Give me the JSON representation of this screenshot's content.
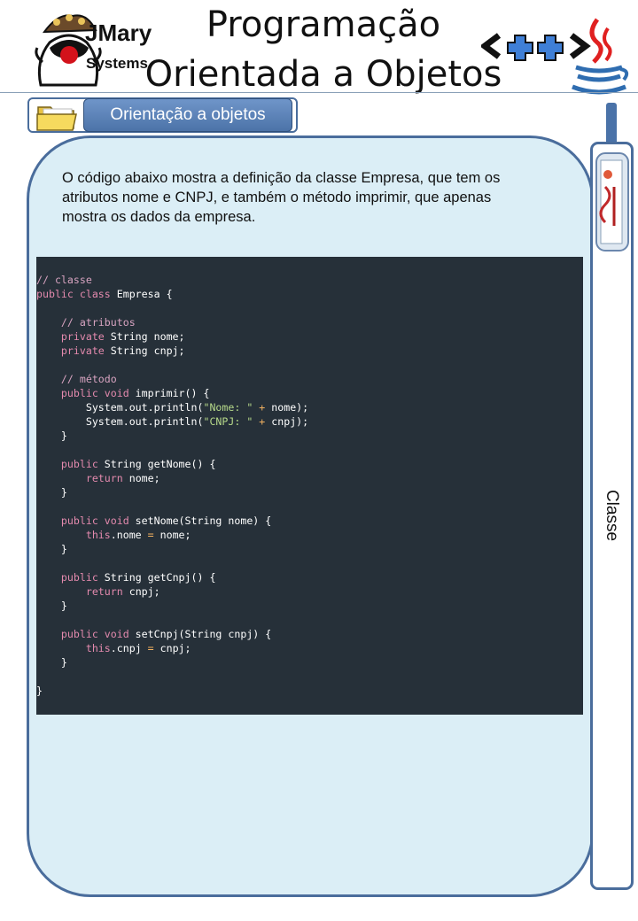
{
  "header": {
    "brand": "JMary",
    "brand_sub": "Systems",
    "title_line1": "Programação",
    "title_line2": "Orientada a Objetos",
    "cpp_logo_text": "<++>"
  },
  "section": {
    "label": "Orientação a objetos",
    "icon": "folder-icon"
  },
  "content": {
    "intro": "O código abaixo mostra a definição da classe Empresa, que tem os atributos nome e CNPJ, e também o método imprimir, que apenas mostra os dados da empresa."
  },
  "code": {
    "lines": [
      [
        {
          "t": "// classe",
          "c": "comment"
        }
      ],
      [
        {
          "t": "public class",
          "c": "keyword"
        },
        {
          "t": " Empresa {",
          "c": "plain"
        }
      ],
      [],
      [
        {
          "t": "    // atributos",
          "c": "comment"
        }
      ],
      [
        {
          "t": "    private",
          "c": "keyword"
        },
        {
          "t": " String nome;",
          "c": "plain"
        }
      ],
      [
        {
          "t": "    private",
          "c": "keyword"
        },
        {
          "t": " String cnpj;",
          "c": "plain"
        }
      ],
      [],
      [
        {
          "t": "    // método",
          "c": "comment"
        }
      ],
      [
        {
          "t": "    public void",
          "c": "keyword"
        },
        {
          "t": " imprimir() {",
          "c": "plain"
        }
      ],
      [
        {
          "t": "        System.out.println(",
          "c": "plain"
        },
        {
          "t": "\"Nome: \"",
          "c": "string"
        },
        {
          "t": " + ",
          "c": "op"
        },
        {
          "t": "nome);",
          "c": "plain"
        }
      ],
      [
        {
          "t": "        System.out.println(",
          "c": "plain"
        },
        {
          "t": "\"CNPJ: \"",
          "c": "string"
        },
        {
          "t": " + ",
          "c": "op"
        },
        {
          "t": "cnpj);",
          "c": "plain"
        }
      ],
      [
        {
          "t": "    }",
          "c": "plain"
        }
      ],
      [],
      [
        {
          "t": "    public",
          "c": "keyword"
        },
        {
          "t": " String getNome() {",
          "c": "plain"
        }
      ],
      [
        {
          "t": "        return",
          "c": "keyword"
        },
        {
          "t": " nome;",
          "c": "plain"
        }
      ],
      [
        {
          "t": "    }",
          "c": "plain"
        }
      ],
      [],
      [
        {
          "t": "    public void",
          "c": "keyword"
        },
        {
          "t": " setNome(String nome) {",
          "c": "plain"
        }
      ],
      [
        {
          "t": "        this",
          "c": "keyword"
        },
        {
          "t": ".nome ",
          "c": "plain"
        },
        {
          "t": "=",
          "c": "op"
        },
        {
          "t": " nome;",
          "c": "plain"
        }
      ],
      [
        {
          "t": "    }",
          "c": "plain"
        }
      ],
      [],
      [
        {
          "t": "    public",
          "c": "keyword"
        },
        {
          "t": " String getCnpj() {",
          "c": "plain"
        }
      ],
      [
        {
          "t": "        return",
          "c": "keyword"
        },
        {
          "t": " cnpj;",
          "c": "plain"
        }
      ],
      [
        {
          "t": "    }",
          "c": "plain"
        }
      ],
      [],
      [
        {
          "t": "    public void",
          "c": "keyword"
        },
        {
          "t": " setCnpj(String cnpj) {",
          "c": "plain"
        }
      ],
      [
        {
          "t": "        this",
          "c": "keyword"
        },
        {
          "t": ".cnpj ",
          "c": "plain"
        },
        {
          "t": "=",
          "c": "op"
        },
        {
          "t": " cnpj;",
          "c": "plain"
        }
      ],
      [
        {
          "t": "    }",
          "c": "plain"
        }
      ],
      [],
      [
        {
          "t": "}",
          "c": "plain"
        }
      ]
    ]
  },
  "sidebar": {
    "label": "Classe",
    "icon": "document-scroll-icon"
  },
  "colors": {
    "panel_bg": "#dbeef6",
    "border": "#4a6d9c",
    "code_bg": "#263039",
    "keyword": "#e48aae",
    "comment": "#d7a3c0",
    "string": "#b6d98a",
    "operator": "#f0b060"
  }
}
